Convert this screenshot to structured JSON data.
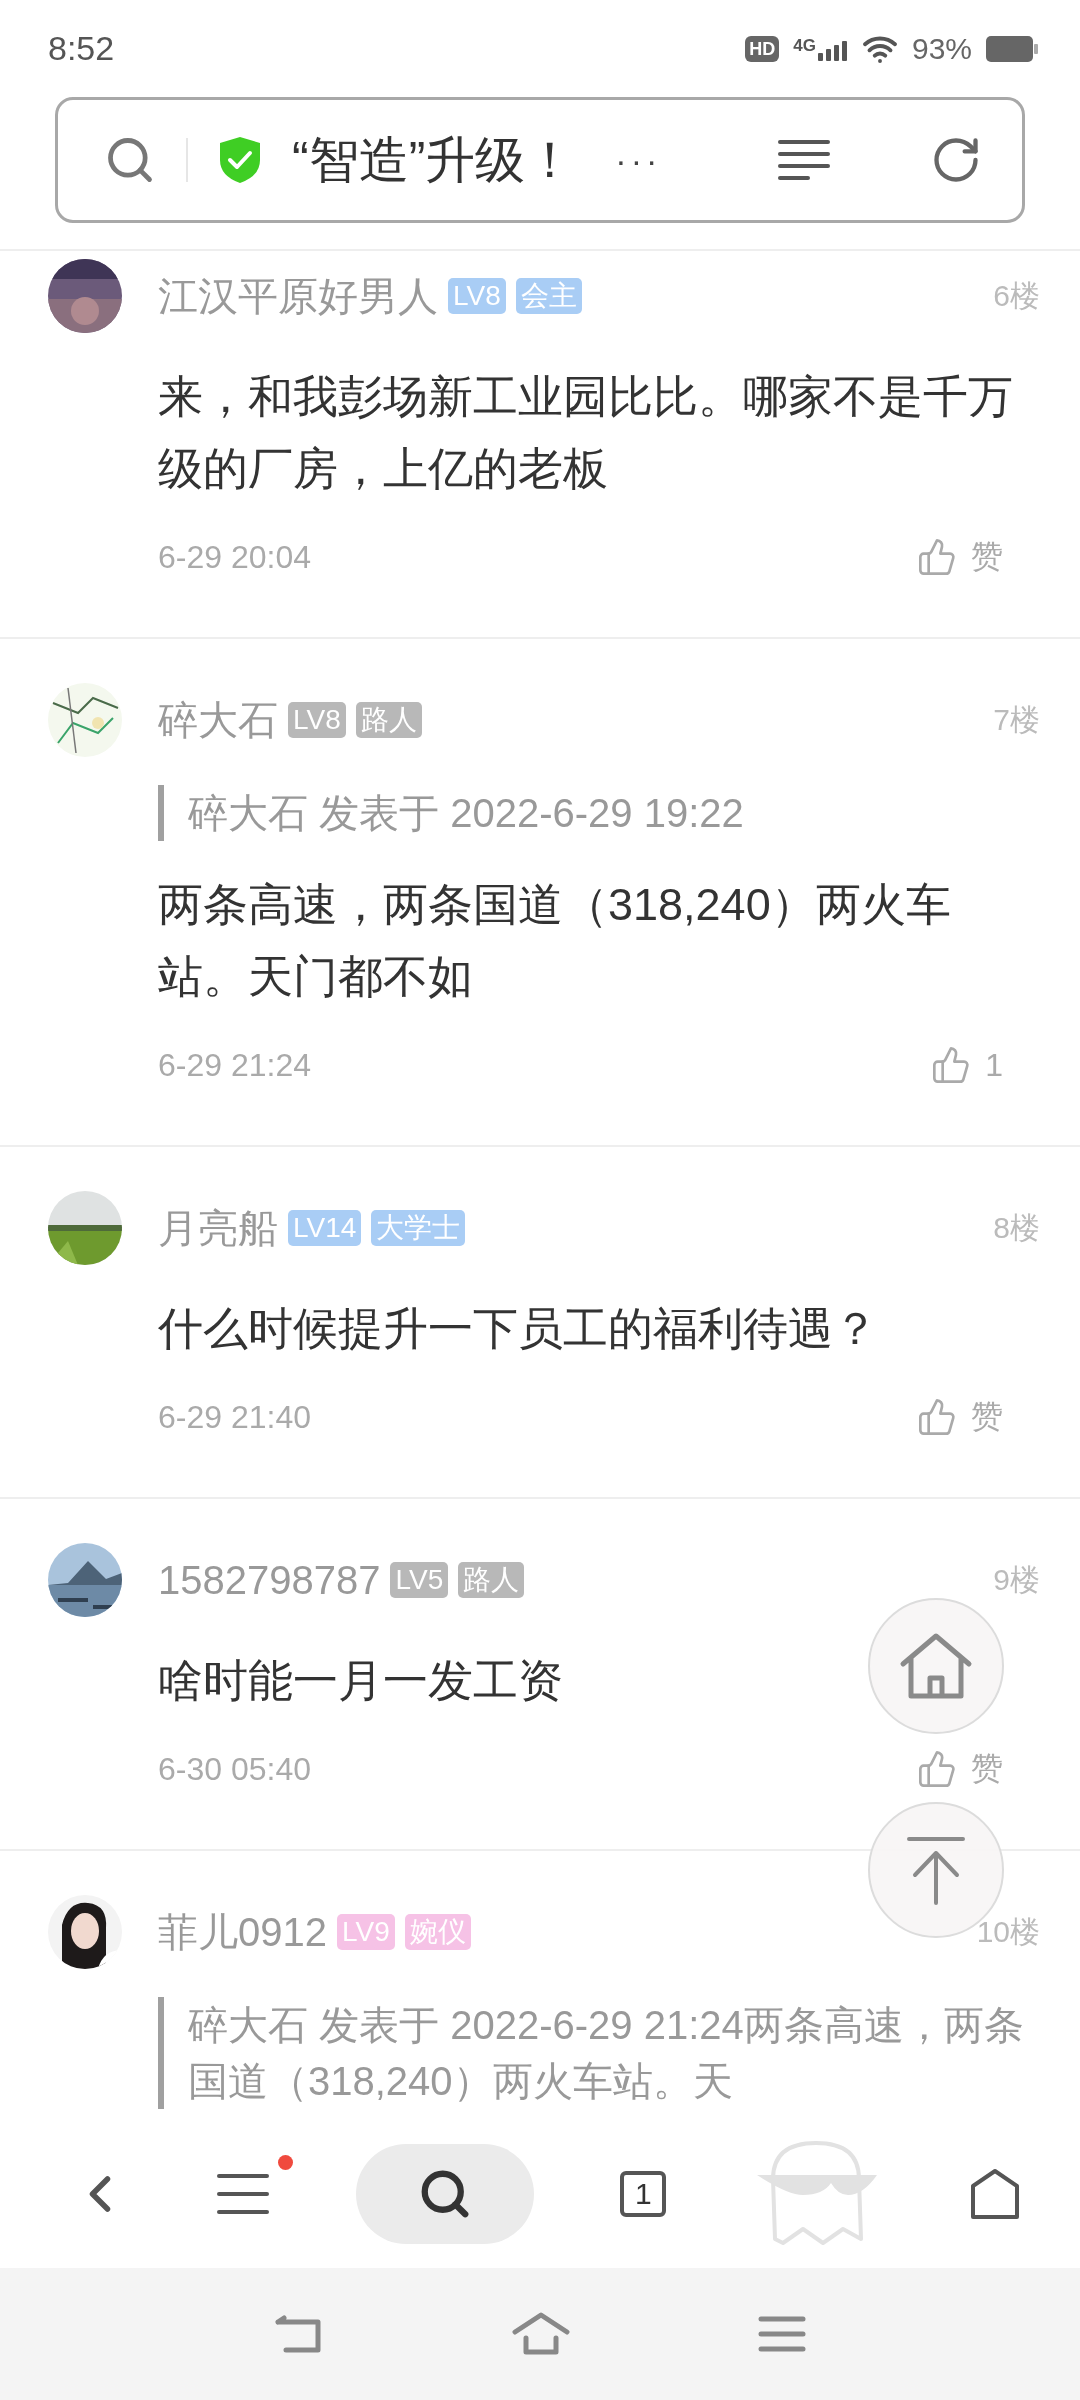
{
  "status_bar": {
    "time": "8:52",
    "hd": "HD",
    "network": "4G",
    "battery": "93%"
  },
  "address_bar": {
    "title": "“智造”升级！",
    "more": "···"
  },
  "posts": [
    {
      "author": "江汉平原好男人",
      "badges": [
        {
          "label": "LV8",
          "color": "#a9cdf5"
        },
        {
          "label": "会主",
          "color": "#a9cdf5"
        }
      ],
      "floor": "6楼",
      "content": "来，和我彭场新工业园比比。哪家不是千万级的厂房，上亿的老板",
      "time": "6-29 20:04",
      "likes": "赞"
    },
    {
      "author": "碎大石",
      "badges": [
        {
          "label": "LV8",
          "color": "#b8b8b8"
        },
        {
          "label": "路人",
          "color": "#b8b8b8"
        }
      ],
      "floor": "7楼",
      "quote": "碎大石 发表于 2022-6-29 19:22",
      "content": "两条高速，两条国道（318,240）两火车站。天门都不如",
      "time": "6-29 21:24",
      "likes": "1"
    },
    {
      "author": "月亮船",
      "badges": [
        {
          "label": "LV14",
          "color": "#a9cdf5"
        },
        {
          "label": "大学士",
          "color": "#a9cdf5"
        }
      ],
      "floor": "8楼",
      "content": "什么时候提升一下员工的福利待遇？",
      "time": "6-29 21:40",
      "likes": "赞"
    },
    {
      "author": "1582798787",
      "badges": [
        {
          "label": "LV5",
          "color": "#b8b8b8"
        },
        {
          "label": "路人",
          "color": "#b8b8b8"
        }
      ],
      "floor": "9楼",
      "content": "啥时能一月一发工资",
      "time": "6-30 05:40",
      "likes": "赞"
    },
    {
      "author": "菲儿0912",
      "badges": [
        {
          "label": "LV9",
          "color": "#f6c2e6"
        },
        {
          "label": "婉仪",
          "color": "#f6c2e6"
        }
      ],
      "floor": "10楼",
      "quote": "碎大石 发表于 2022-6-29 21:24两条高速，两条国道（318,240）两火车站。天"
    }
  ],
  "bottom_nav": {
    "tab_count": "1",
    "menu_badge": true
  }
}
